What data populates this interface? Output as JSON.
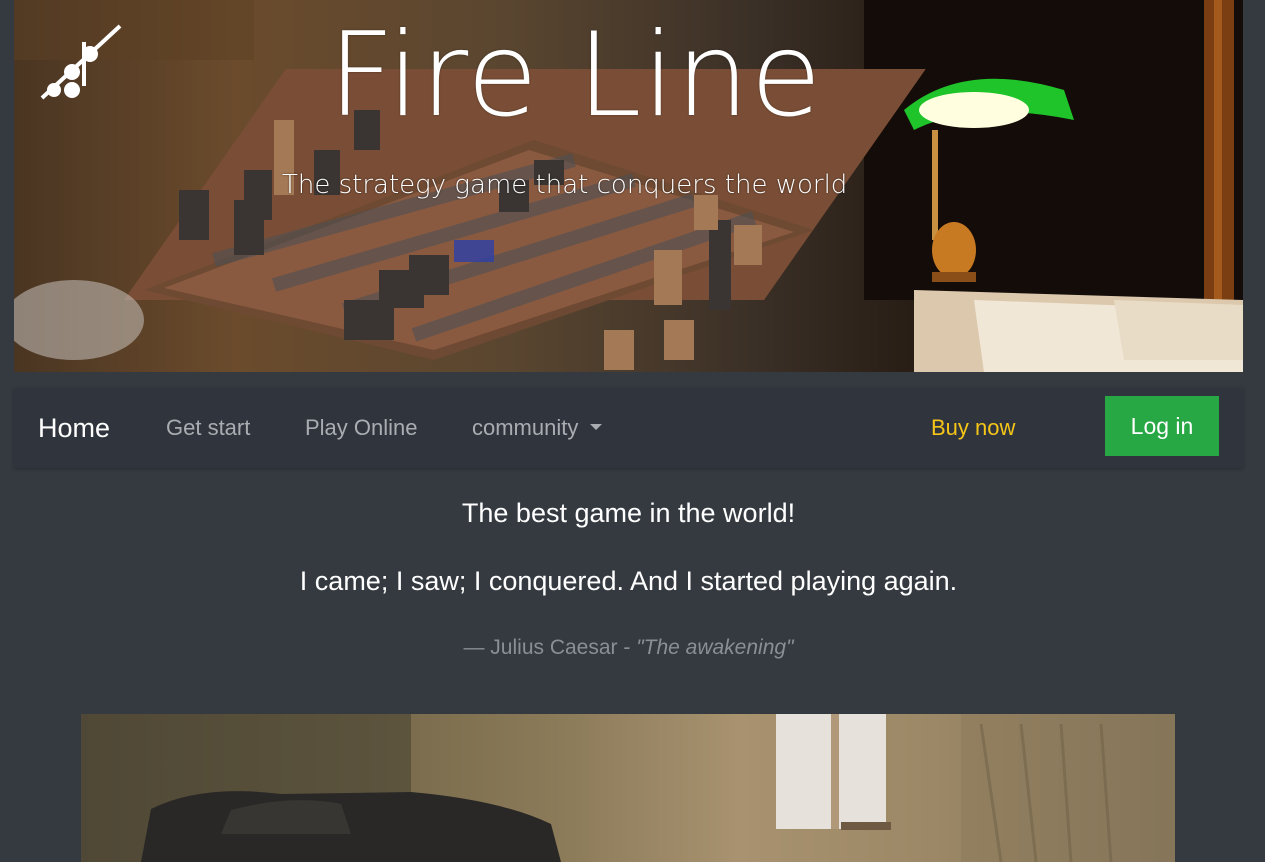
{
  "hero": {
    "title": "Fire Line",
    "subtitle": "The strategy game that conquers the world",
    "logo_icon": "fire-line-logo-icon",
    "image": "chessboard-with-desk-lamp-photo"
  },
  "navbar": {
    "items": [
      {
        "label": "Home",
        "active": true
      },
      {
        "label": "Get start"
      },
      {
        "label": "Play Online"
      },
      {
        "label": "community",
        "dropdown": true,
        "icon": "caret-down-icon"
      }
    ],
    "buy_label": "Buy now",
    "login_label": "Log in",
    "colors": {
      "buy": "#f5c518",
      "login_bg": "#28a745",
      "background": "#343a40"
    }
  },
  "quote": {
    "title": "The best game in the world!",
    "text": "I came; I saw; I conquered. And I started playing again.",
    "author": "— Julius Caesar - ",
    "source": "\"The awakening\""
  },
  "bottom_image": {
    "image": "blurred-room-photo"
  }
}
